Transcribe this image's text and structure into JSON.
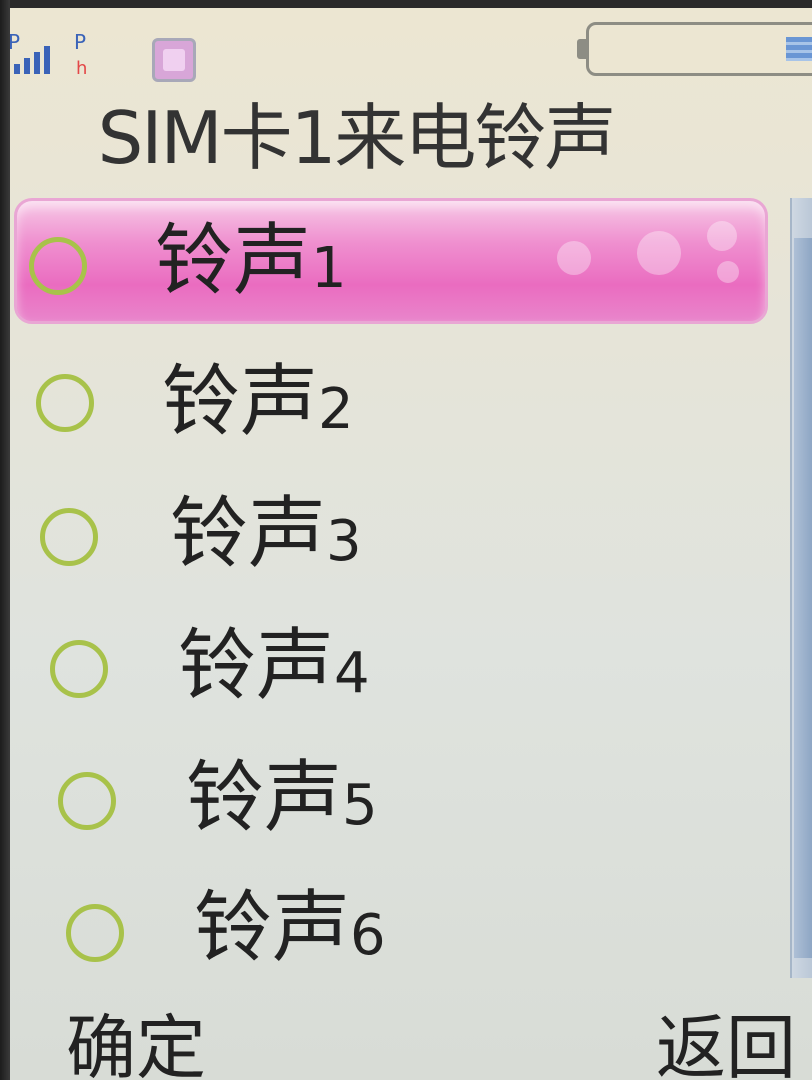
{
  "status_bar": {
    "signal_letter": "P",
    "gprs_letter": "P",
    "gprs_sub": "h",
    "signal_icon": "signal-bars-icon",
    "sim_icon": "sim-card-icon",
    "battery_icon": "battery-icon"
  },
  "screen": {
    "title": "SIM卡1来电铃声"
  },
  "ringtones": [
    {
      "name": "铃声",
      "num": "1",
      "selected": true
    },
    {
      "name": "铃声",
      "num": "2",
      "selected": false
    },
    {
      "name": "铃声",
      "num": "3",
      "selected": false
    },
    {
      "name": "铃声",
      "num": "4",
      "selected": false
    },
    {
      "name": "铃声",
      "num": "5",
      "selected": false
    },
    {
      "name": "铃声",
      "num": "6",
      "selected": false
    }
  ],
  "softkeys": {
    "left": "确定",
    "right": "返回"
  },
  "colors": {
    "highlight": "#ea6cc0",
    "radio": "#a8c24a",
    "signal": "#3a63b8"
  }
}
